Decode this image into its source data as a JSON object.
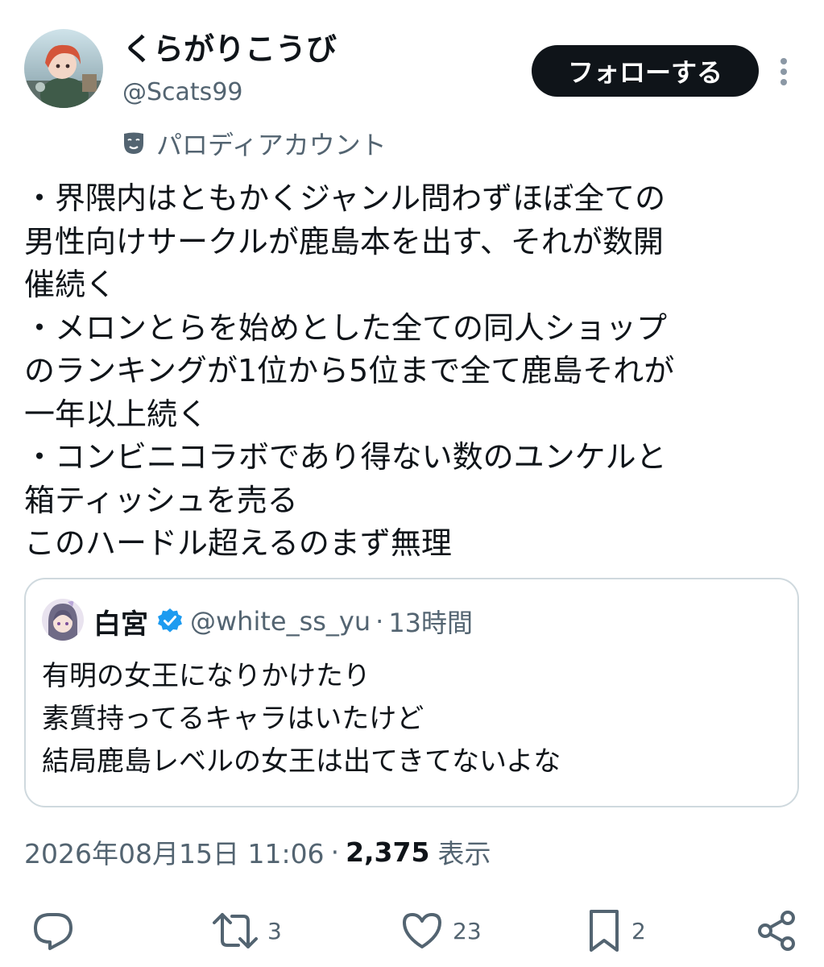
{
  "author": {
    "name": "くらがりこうび",
    "handle": "@Scats99",
    "label": "パロディアカウント"
  },
  "follow_button": "フォローする",
  "post": {
    "lines": [
      "・界隈内はともかくジャンル問わずほぼ全ての",
      "男性向けサークルが鹿島本を出す、それが数開",
      "催続く",
      "・メロンとらを始めとした全ての同人ショップ",
      "のランキングが1位から5位まで全て鹿島それが",
      "一年以上続く",
      "・コンビニコラボであり得ない数のユンケルと",
      "箱ティッシュを売る",
      "このハードル超えるのまず無理"
    ]
  },
  "quote": {
    "name": "白宮",
    "handle": "@white_ss_yu",
    "separator": "·",
    "time": "13時間",
    "lines": [
      "有明の女王になりかけたり",
      "素質持ってるキャラはいたけど",
      "結局鹿島レベルの女王は出てきてないよな"
    ]
  },
  "meta": {
    "timestamp": "2026年08月15日 11:06",
    "dot": "·",
    "views": "2,375",
    "views_label": "表示"
  },
  "actions": {
    "reply": "",
    "retweets": "3",
    "likes": "23",
    "bookmarks": "2"
  },
  "icons": {
    "parody": "theater-mask-icon",
    "verified": "verified-badge-icon",
    "reply": "reply-icon",
    "retweet": "retweet-icon",
    "like": "heart-icon",
    "bookmark": "bookmark-icon",
    "share": "share-icon",
    "more": "more-vertical-icon"
  },
  "colors": {
    "text": "#0f1419",
    "secondary": "#536471",
    "verified": "#1d9bf0",
    "border": "#cfd9de"
  }
}
